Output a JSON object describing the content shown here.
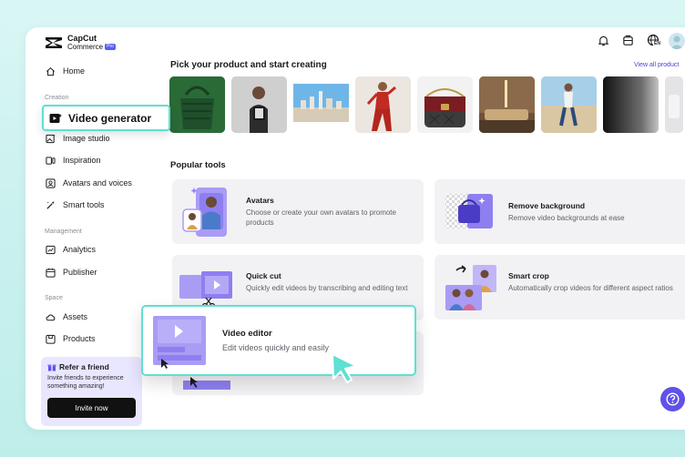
{
  "brand": {
    "line1": "CapCut",
    "line2": "Commerce",
    "badge": "Pro"
  },
  "sidebar": {
    "home": "Home",
    "creation_label": "Creation",
    "video_generator": "Video generator",
    "image_studio": "Image studio",
    "inspiration": "Inspiration",
    "avatars_voices": "Avatars and voices",
    "smart_tools": "Smart tools",
    "management_label": "Management",
    "analytics": "Analytics",
    "publisher": "Publisher",
    "space_label": "Space",
    "assets": "Assets",
    "products": "Products"
  },
  "refer": {
    "title": "Refer a friend",
    "desc": "Invite friends to experience something amazing!",
    "button": "Invite now"
  },
  "header": {
    "title": "Pick your product and start creating",
    "view_all": "View all product",
    "lang_badge": "EN"
  },
  "popular": {
    "title": "Popular tools",
    "tools": [
      {
        "name": "Avatars",
        "desc": "Choose or create your own avatars to promote products"
      },
      {
        "name": "Remove background",
        "desc": "Remove video backgrounds at ease"
      },
      {
        "name": "Quick cut",
        "desc": "Quickly edit videos by transcribing and editing text"
      },
      {
        "name": "Smart crop",
        "desc": "Automatically crop videos for different aspect ratios"
      }
    ]
  },
  "video_editor": {
    "name": "Video editor",
    "desc": "Edit videos quickly and easily"
  },
  "colors": {
    "accent": "#5ee0d2",
    "brand_purple": "#5e52e8",
    "link": "#4b43d8"
  }
}
